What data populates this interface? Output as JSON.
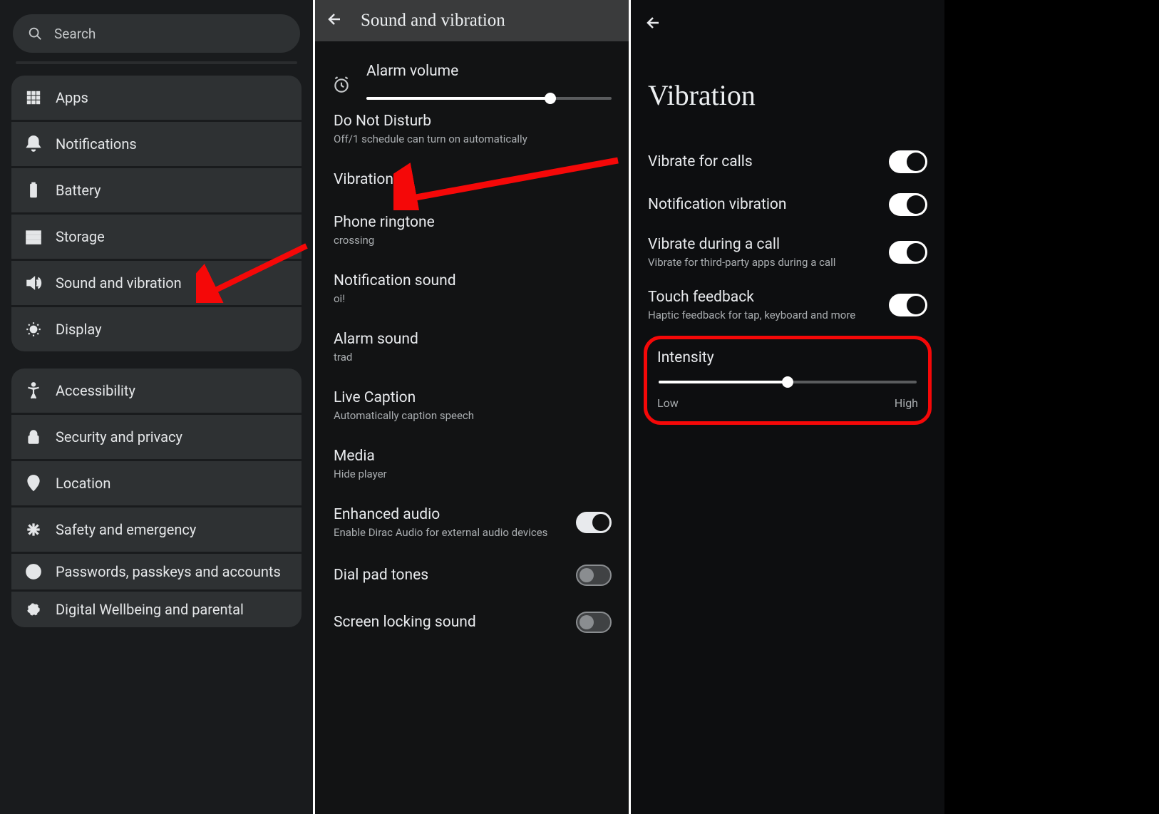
{
  "panel1": {
    "search_placeholder": "Search",
    "group1": [
      {
        "label": "Apps"
      },
      {
        "label": "Notifications"
      },
      {
        "label": "Battery"
      },
      {
        "label": "Storage"
      },
      {
        "label": "Sound and vibration"
      },
      {
        "label": "Display"
      }
    ],
    "group2": [
      {
        "label": "Accessibility"
      },
      {
        "label": "Security and privacy"
      },
      {
        "label": "Location"
      },
      {
        "label": "Safety and emergency"
      },
      {
        "label": "Passwords, passkeys and accounts"
      },
      {
        "label": "Digital Wellbeing and parental"
      }
    ]
  },
  "panel2": {
    "title": "Sound and vibration",
    "alarm": {
      "title": "Alarm volume",
      "value_pct": 75
    },
    "items": [
      {
        "title": "Do Not Disturb",
        "sub": "Off/1 schedule can turn on automatically"
      },
      {
        "title": "Vibration"
      },
      {
        "title": "Phone ringtone",
        "sub": "crossing"
      },
      {
        "title": "Notification sound",
        "sub": "oi!"
      },
      {
        "title": "Alarm sound",
        "sub": "trad"
      },
      {
        "title": "Live Caption",
        "sub": "Automatically caption speech"
      },
      {
        "title": "Media",
        "sub": "Hide player"
      },
      {
        "title": "Enhanced audio",
        "sub": "Enable Dirac Audio for external audio devices",
        "toggle": "on"
      },
      {
        "title": "Dial pad tones",
        "toggle": "off"
      },
      {
        "title": "Screen locking sound",
        "toggle": "off"
      }
    ]
  },
  "panel3": {
    "title": "Vibration",
    "items": [
      {
        "title": "Vibrate for calls",
        "toggle": "on"
      },
      {
        "title": "Notification vibration",
        "toggle": "on"
      },
      {
        "title": "Vibrate during a call",
        "sub": "Vibrate for third-party apps during a call",
        "toggle": "on"
      },
      {
        "title": "Touch feedback",
        "sub": "Haptic feedback for tap, keyboard and more",
        "toggle": "on"
      }
    ],
    "intensity": {
      "title": "Intensity",
      "value_pct": 50,
      "low": "Low",
      "high": "High"
    }
  }
}
